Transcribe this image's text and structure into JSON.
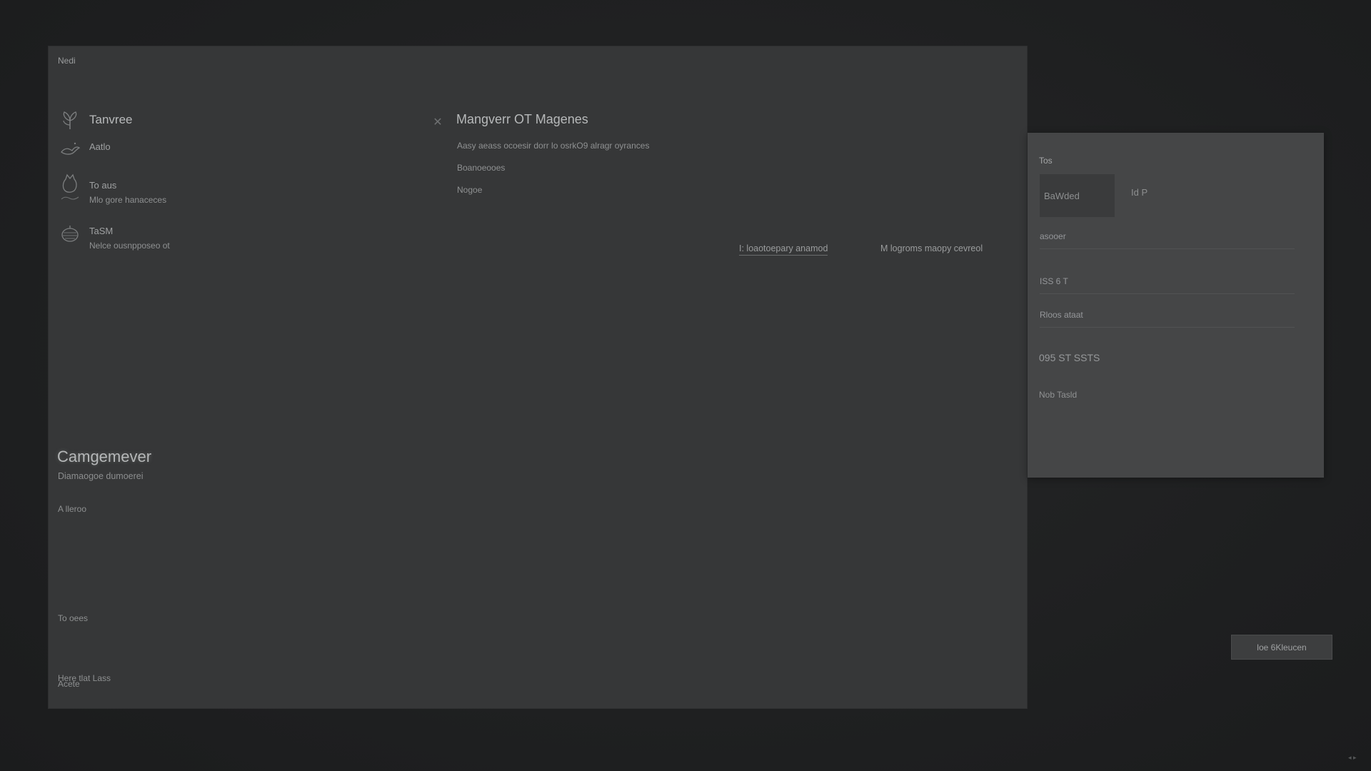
{
  "main_panel": {
    "title": "Nedi"
  },
  "sidebar": {
    "features": [
      {
        "name": "Tanvree",
        "desc": "",
        "icon": "plant-icon"
      },
      {
        "name": "Aatlo",
        "desc": "",
        "icon": "bird-icon"
      },
      {
        "name": "To aus",
        "desc": "Mlo gore hanaceces",
        "icon": "cat-icon"
      },
      {
        "name": "TaSM",
        "desc": "Nelce ousnpposeo ot",
        "icon": "pinecone-icon"
      }
    ],
    "section_heading": "Camgemever",
    "section_sub": "Diamaogoe dumoerei",
    "items": [
      "A lleroo",
      "To oees",
      "Acete",
      "Here tlat Lass"
    ]
  },
  "content": {
    "title": "Mangverr OT Magenes",
    "lines": [
      "Aasy aeass ocoesir dorr lo osrkO9 alragr oyrances",
      "Boanoeooes",
      "Nogoe"
    ],
    "links": [
      "I: loaotoepary anamod",
      "M logroms maopy cevreol"
    ]
  },
  "right_panel": {
    "title": "Tos",
    "chip_label": "BaWded",
    "chip_value": "Id P",
    "rows": [
      "asooer",
      "ISS 6 T",
      "Rloos ataat"
    ],
    "big_value": "095 ST SSTS",
    "footer": "Nob Tasld"
  },
  "action_button": {
    "label": "loe 6Kleucen"
  },
  "colors": {
    "background": "#1f2021",
    "main_panel": "#363738",
    "right_panel": "#454647"
  }
}
